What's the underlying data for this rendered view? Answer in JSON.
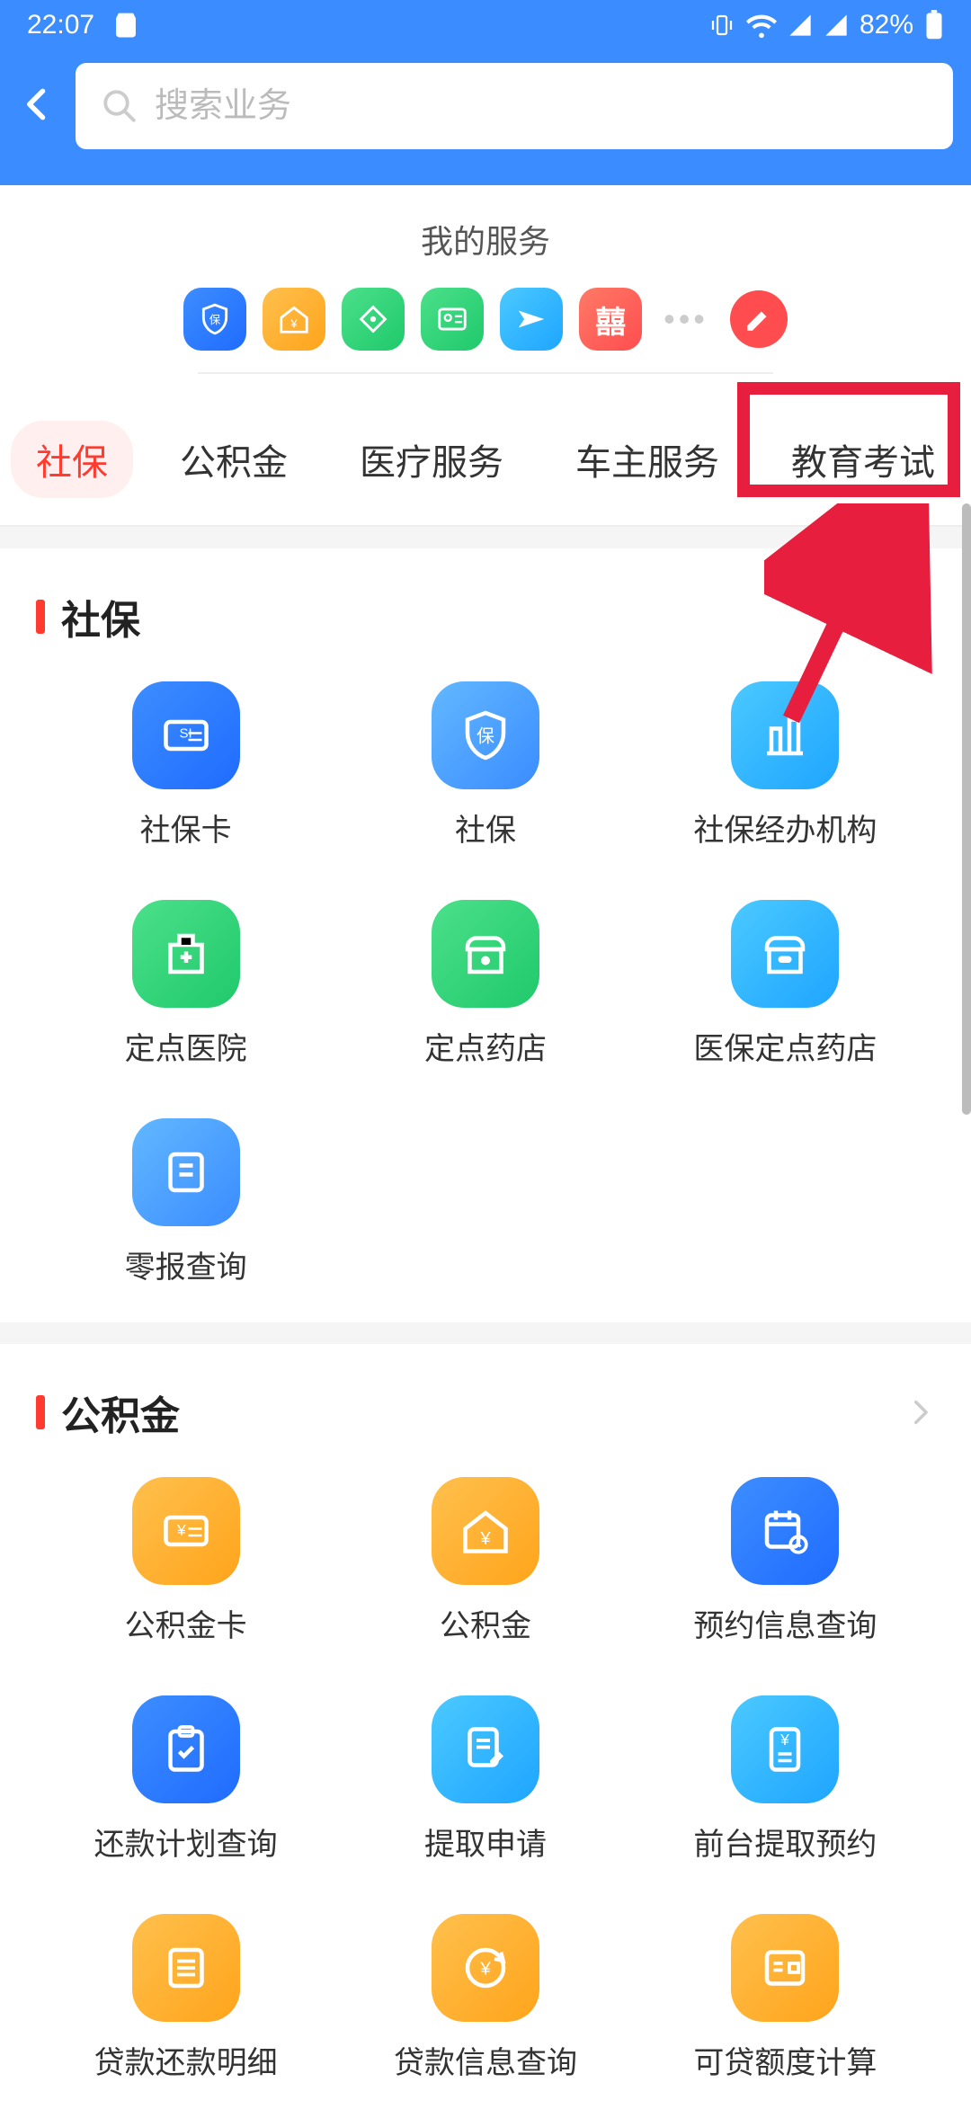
{
  "status": {
    "time": "22:07",
    "battery_pct": "82%"
  },
  "search": {
    "placeholder": "搜索业务"
  },
  "my_services": {
    "title": "我的服务",
    "quick_icons": [
      {
        "name": "insurance-icon",
        "bg": "g-blue"
      },
      {
        "name": "home-fund-icon",
        "bg": "g-yellow"
      },
      {
        "name": "diamond-icon",
        "bg": "g-green"
      },
      {
        "name": "id-card-icon",
        "bg": "g-green"
      },
      {
        "name": "plane-icon",
        "bg": "g-cyan"
      },
      {
        "name": "double-happiness-icon",
        "bg": "g-red"
      }
    ]
  },
  "tabs": [
    {
      "label": "社保",
      "active": true
    },
    {
      "label": "公积金",
      "active": false
    },
    {
      "label": "医疗服务",
      "active": false
    },
    {
      "label": "车主服务",
      "active": false
    },
    {
      "label": "教育考试",
      "active": false
    }
  ],
  "sections": [
    {
      "title": "社保",
      "items": [
        {
          "label": "社保卡",
          "icon": "card-icon",
          "bg": "g-blue"
        },
        {
          "label": "社保",
          "icon": "shield-icon",
          "bg": "g-blue2"
        },
        {
          "label": "社保经办机构",
          "icon": "building-icon",
          "bg": "g-cyan"
        },
        {
          "label": "定点医院",
          "icon": "hospital-icon",
          "bg": "g-green"
        },
        {
          "label": "定点药店",
          "icon": "pharmacy-icon",
          "bg": "g-green"
        },
        {
          "label": "医保定点药店",
          "icon": "medical-store-icon",
          "bg": "g-cyan"
        },
        {
          "label": "零报查询",
          "icon": "report-icon",
          "bg": "g-blue2"
        }
      ]
    },
    {
      "title": "公积金",
      "items": [
        {
          "label": "公积金卡",
          "icon": "fund-card-icon",
          "bg": "g-yellow"
        },
        {
          "label": "公积金",
          "icon": "fund-house-icon",
          "bg": "g-yellow"
        },
        {
          "label": "预约信息查询",
          "icon": "calendar-icon",
          "bg": "g-blue"
        },
        {
          "label": "还款计划查询",
          "icon": "clipboard-check-icon",
          "bg": "g-blue"
        },
        {
          "label": "提取申请",
          "icon": "document-edit-icon",
          "bg": "g-cyan"
        },
        {
          "label": "前台提取预约",
          "icon": "receipt-icon",
          "bg": "g-cyan"
        },
        {
          "label": "贷款还款明细",
          "icon": "list-icon",
          "bg": "g-yellow"
        },
        {
          "label": "贷款信息查询",
          "icon": "refresh-yen-icon",
          "bg": "g-yellow"
        },
        {
          "label": "可贷额度计算",
          "icon": "list-card-icon",
          "bg": "g-yellow"
        }
      ]
    }
  ],
  "colors": {
    "primary": "#3a8cff",
    "accent": "#ff3b30",
    "annotation": "#e81e3e"
  }
}
